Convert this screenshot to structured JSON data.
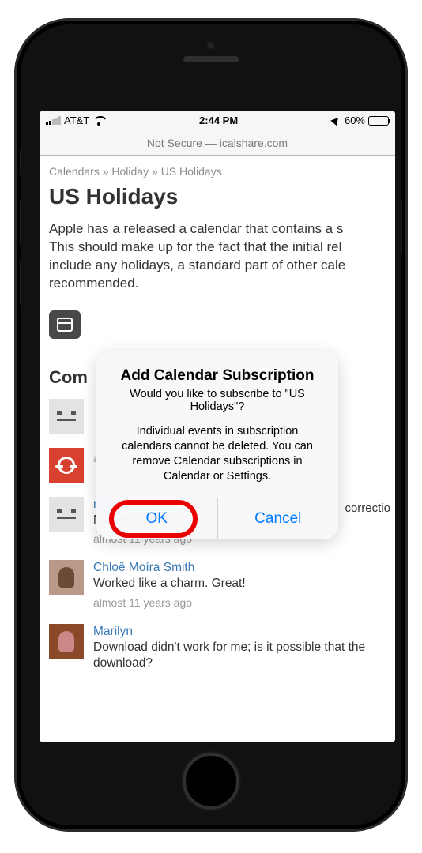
{
  "status": {
    "carrier": "AT&T",
    "time": "2:44 PM",
    "battery_pct": "60%",
    "battery_fill_pct": 60
  },
  "urlbar": {
    "text": "Not Secure — icalshare.com"
  },
  "breadcrumb": {
    "a": "Calendars",
    "b": "Holiday",
    "c": "US Holidays",
    "sep": "»"
  },
  "page": {
    "title": "US Holidays",
    "para_line1": "Apple has a released a calendar that contains a s",
    "para_line2": "This should make up for the fact that the initial rel",
    "para_line3": "include any holidays, a standard part of other cale",
    "para_line4": "recommended."
  },
  "comments": {
    "heading_prefix": "Com",
    "items": [
      {
        "user": "",
        "text": "",
        "time": ""
      },
      {
        "user": "",
        "text": "",
        "time": "almost 9 years ago"
      },
      {
        "user": "micholasgrace",
        "text": "Me Neither!!!!!!!!",
        "time": "almost 11 years ago"
      },
      {
        "user": "Chloë Moíra Smith",
        "text": "Worked like a charm. Great!",
        "time": "almost 11 years ago"
      },
      {
        "user": "Marilyn",
        "text": "Download didn't work for me; is it possible that the download?",
        "time": ""
      }
    ],
    "side_label": "correctio"
  },
  "alert": {
    "title": "Add Calendar Subscription",
    "sub": "Would you like to subscribe to \"US Holidays\"?",
    "detail": "Individual events in subscription calendars cannot be deleted. You can remove Calendar subscriptions in Calendar or Settings.",
    "ok": "OK",
    "cancel": "Cancel"
  }
}
